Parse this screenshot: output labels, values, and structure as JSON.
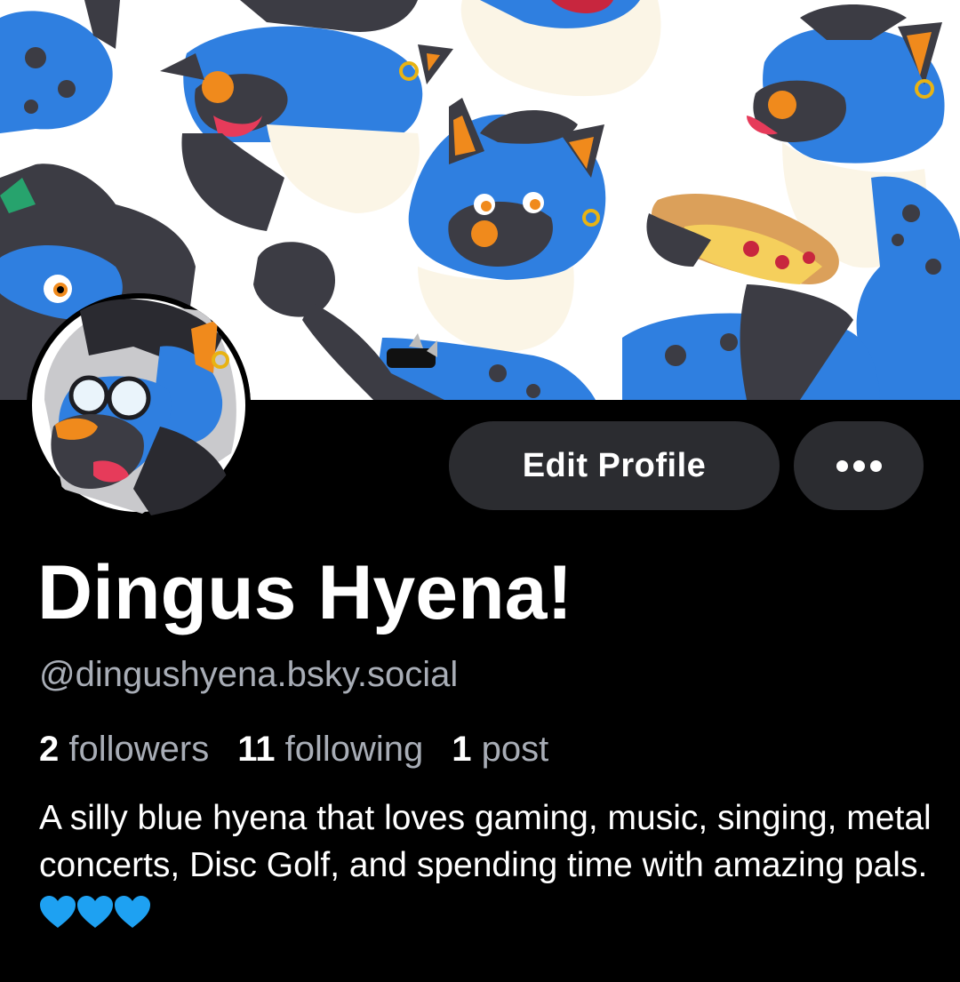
{
  "banner": {
    "icon": "hyena-character-art-banner"
  },
  "avatar": {
    "icon": "hyena-avatar-with-glasses"
  },
  "actions": {
    "edit_profile_label": "Edit Profile",
    "more_icon": "ellipsis-icon"
  },
  "profile": {
    "display_name": "Dingus Hyena!",
    "handle": "@dingushyena.bsky.social"
  },
  "stats": {
    "followers_count": "2",
    "followers_label": "followers",
    "following_count": "11",
    "following_label": "following",
    "posts_count": "1",
    "posts_label": "post"
  },
  "bio": {
    "text": "A silly blue hyena that loves gaming, music, singing, metal concerts, Disc Golf, and spending time with amazing pals.",
    "emoji": [
      "blue-heart-icon",
      "blue-heart-icon",
      "blue-heart-icon"
    ]
  },
  "colors": {
    "background": "#000000",
    "button": "#2b2c30",
    "muted_text": "#a8adb6",
    "hyena_blue": "#2f7fe0",
    "heart_blue": "#1ea1f2"
  }
}
